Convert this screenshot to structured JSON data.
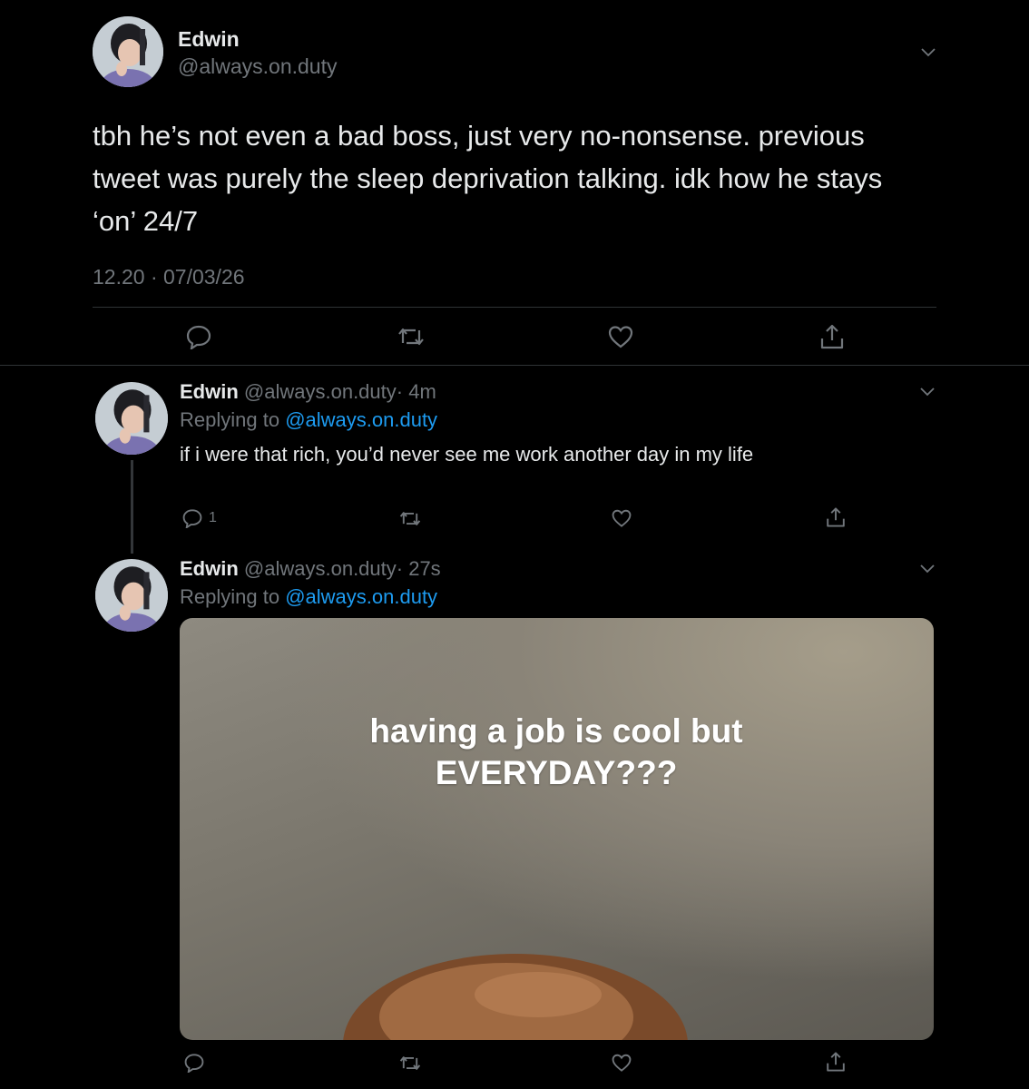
{
  "main_tweet": {
    "name": "Edwin",
    "handle": "@always.on.duty",
    "text": "tbh he’s not even a bad boss, just very no-nonsense. previous tweet was purely the sleep deprivation talking. idk how he stays ‘on’ 24/7",
    "timestamp": "12.20 · 07/03/26"
  },
  "replies": [
    {
      "name": "Edwin",
      "handle": "@always.on.duty",
      "time": "· 4m",
      "replying_prefix": "Replying to",
      "replying_handle": "@always.on.duty",
      "text": "if i were that rich, you’d never see me work another day in my life",
      "reply_count": "1"
    },
    {
      "name": "Edwin",
      "handle": "@always.on.duty",
      "time": "· 27s",
      "replying_prefix": "Replying to",
      "replying_handle": "@always.on.duty",
      "media_caption": "having a job is cool but EVERYDAY???"
    }
  ],
  "icons": {
    "reply": "reply-icon",
    "retweet": "retweet-icon",
    "like": "like-icon",
    "share": "share-icon",
    "more": "chevron-down-icon"
  },
  "colors": {
    "background": "#000000",
    "text": "#e7e9ea",
    "muted": "#71767b",
    "link": "#1d9bf0",
    "divider": "#2f3336"
  }
}
